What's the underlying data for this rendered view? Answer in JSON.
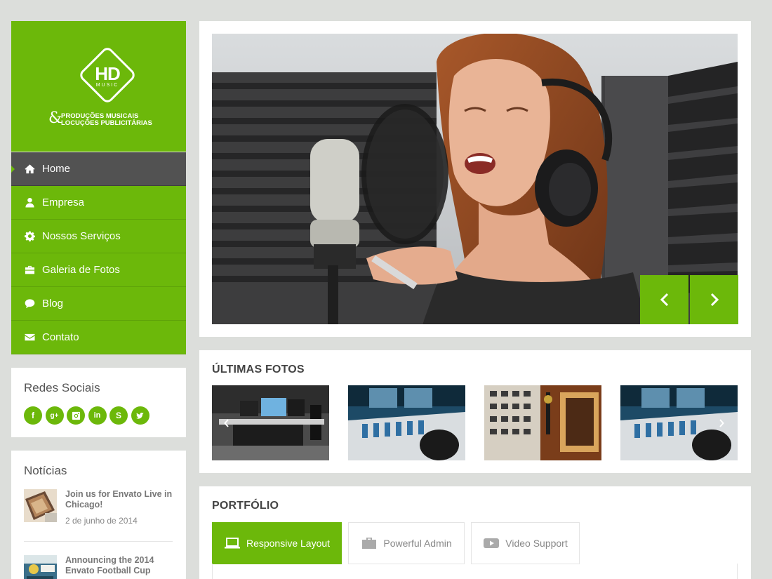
{
  "logo": {
    "main": "HD",
    "sub": "MUSIC",
    "ampersand": "&",
    "line1": "PRODUÇÕES MUSICAIS",
    "line2": "LOCUÇÕES PUBLICITÁRIAS"
  },
  "nav": {
    "items": [
      {
        "label": "Home",
        "icon": "home-icon",
        "active": true
      },
      {
        "label": "Empresa",
        "icon": "user-icon"
      },
      {
        "label": "Nossos Serviços",
        "icon": "gear-icon"
      },
      {
        "label": "Galeria de Fotos",
        "icon": "briefcase-icon"
      },
      {
        "label": "Blog",
        "icon": "comment-icon"
      },
      {
        "label": "Contato",
        "icon": "envelope-icon"
      }
    ]
  },
  "social": {
    "heading": "Redes Sociais",
    "icons": [
      "facebook-icon",
      "google-plus-icon",
      "instagram-icon",
      "linkedin-icon",
      "skype-icon",
      "twitter-icon"
    ],
    "glyphs": [
      "f",
      "g+",
      "◙",
      "in",
      "S",
      "t"
    ]
  },
  "news": {
    "heading": "Notícias",
    "items": [
      {
        "title": "Join us for Envato Live in Chicago!",
        "date": "2 de junho de 2014"
      },
      {
        "title": "Announcing the 2014 Envato Football Cup",
        "date": ""
      }
    ]
  },
  "slider": {
    "prev_icon": "chevron-left-icon",
    "next_icon": "chevron-right-icon"
  },
  "photos": {
    "title": "ÚLTIMAS FOTOS"
  },
  "portfolio": {
    "title": "PORTFÓLIO",
    "tabs": [
      {
        "label": "Responsive Layout",
        "icon": "laptop-icon",
        "active": true
      },
      {
        "label": "Powerful Admin",
        "icon": "briefcase-icon"
      },
      {
        "label": "Video Support",
        "icon": "video-play-icon"
      }
    ]
  },
  "colors": {
    "accent": "#6cb80a",
    "nav_active": "#525252",
    "background": "#dcdedb"
  }
}
